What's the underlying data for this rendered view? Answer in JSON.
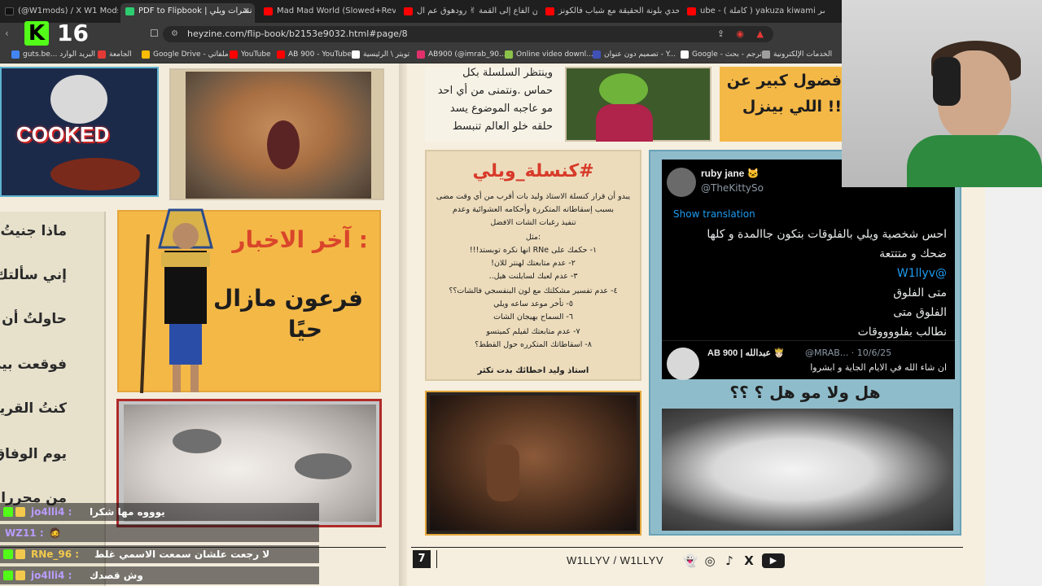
{
  "tabs": [
    {
      "title": "(@W1mods) / X W1 Mods",
      "icon_color": "#1d1d1d"
    },
    {
      "title": "PDF to Flipbook | نشرات ويلي",
      "icon_color": "#2ecc71",
      "active": true,
      "close": "✕"
    },
    {
      "title": "Mad Mad World (Slowed+Reverb) -",
      "icon_color": "#ff0000"
    },
    {
      "title": "من الفاع إلى القمة ✌ رودهوق عم ال",
      "icon_color": "#ff0000"
    },
    {
      "title": "تحدي بلونة الحقيقة مع شباب فالكونز",
      "icon_color": "#ff0000"
    },
    {
      "title": "ube - ( كاملة ) yakuza kiwami مختصر",
      "icon_color": "#ff0000"
    }
  ],
  "kick": {
    "logo": "K",
    "count": "16"
  },
  "address": {
    "url": "heyzine.com/flip-book/b2153e9032.html#page/8"
  },
  "bookmarks": [
    {
      "label": "guts.be... البريد الوارد",
      "color": "#4285f4"
    },
    {
      "label": "الجامعة",
      "color": "#e53935"
    },
    {
      "label": "Google Drive - ملفاتي",
      "color": "#fbbc04"
    },
    {
      "label": "YouTube",
      "color": "#ff0000"
    },
    {
      "label": "AB 900 - YouTube",
      "color": "#ff0000"
    },
    {
      "label": "تويتر \\ الرئيسية",
      "color": "#ffffff"
    },
    {
      "label": "AB900 (@imrab_90...",
      "color": "#e1306c"
    },
    {
      "label": "Online video downl...",
      "color": "#8bc34a"
    },
    {
      "label": "تصميم دون عنوان - Y...",
      "color": "#3f51b5"
    },
    {
      "label": "Google - ترجم - بحث",
      "color": "#ffffff"
    },
    {
      "label": "الخدمات الإلكترونية",
      "color": "#9e9e9e"
    }
  ],
  "page_left": {
    "cooked_text": "COOKED",
    "poem_lines": [
      "ماذا جنيتُ",
      "إني سألتك",
      "حاولتُ أن أ",
      "فوقعت بين",
      "كنتُ القريب",
      "يوم الوفاق",
      "من محررات النش"
    ],
    "news": {
      "heading": ": آخر الاخبار",
      "line1": "فرعون مازال",
      "line2": "حيًا"
    }
  },
  "page_right": {
    "top_mid": [
      "وينتظر السلسلة بكل",
      "حماس .ونتمنى من أي احد",
      "مو عاجبه الموضوع يسد",
      "حلقه خلو العالم تنبسط"
    ],
    "top_right": [
      "فضول كبير عن",
      "!! اللي بينزل"
    ],
    "consela": {
      "heading": "#كنسلة_ويلي",
      "lines": [
        "يبدو أن قرار كنسلة الاستاذ وليد بات أقرب من أي وقت مضى",
        "بسبب إسقاطاته المتكررة وأحكامه العشوائية وعدم",
        "تنفيذ رغبات الشات الافضل",
        ":مثل",
        "١- حكمك على RNe انها نكره توبستد!!!",
        "٢- عدم متابعتك لهنتر للان!",
        "٣- عدم لعبك لسايلنت هيل..",
        "٤- عدم تفسير مشكلتك مع لون البنفسجي فالشات؟؟",
        "٥- تأخر موعد ساعه ويلي",
        "٦- السماح بهيجان الشات",
        "٧- عدم متابعتك لفيلم كميتسو",
        "٨- اسقاطاتك المتكرره حول القطط؟"
      ],
      "signature": "استاذ وليد اخطائك بدت تكثر"
    },
    "tweet": {
      "name": "ruby jane 🐱",
      "handle": "@TheKittySo",
      "translate": "Show translation",
      "body": [
        "احس شخصية ويلي بالفلوقات بتكون جاالمدة و كلها",
        "ضحك و متتتعة",
        "@W1llyv",
        "متى الفلوق",
        "الفلوق متى",
        "نطالب بفلووووقات"
      ],
      "reply_name": "AB 900 | عبدالله 🤴🏻",
      "reply_handle": "@MRAB... · 10/6/25",
      "reply_text": "ان شاء الله في الايام الجاية و ابشروا"
    },
    "question": "هل ولا مو هل ؟ ؟؟"
  },
  "footer": {
    "page_number": "7",
    "brand": "W1LLYV / W1LLYV"
  },
  "chat": [
    {
      "user": "jo4lli4 :",
      "text": "يوووه مها شكرا",
      "color": "#b99cff"
    },
    {
      "user": "WZ11 :",
      "text": "🧔",
      "color": "#b99cff"
    },
    {
      "user": "RNe_96 :",
      "text": "لا رجعت علشان سمعت الاسمي غلط",
      "color": "#f2c94c"
    },
    {
      "user": "jo4lli4 :",
      "text": "وش قصدك",
      "color": "#b99cff"
    }
  ]
}
